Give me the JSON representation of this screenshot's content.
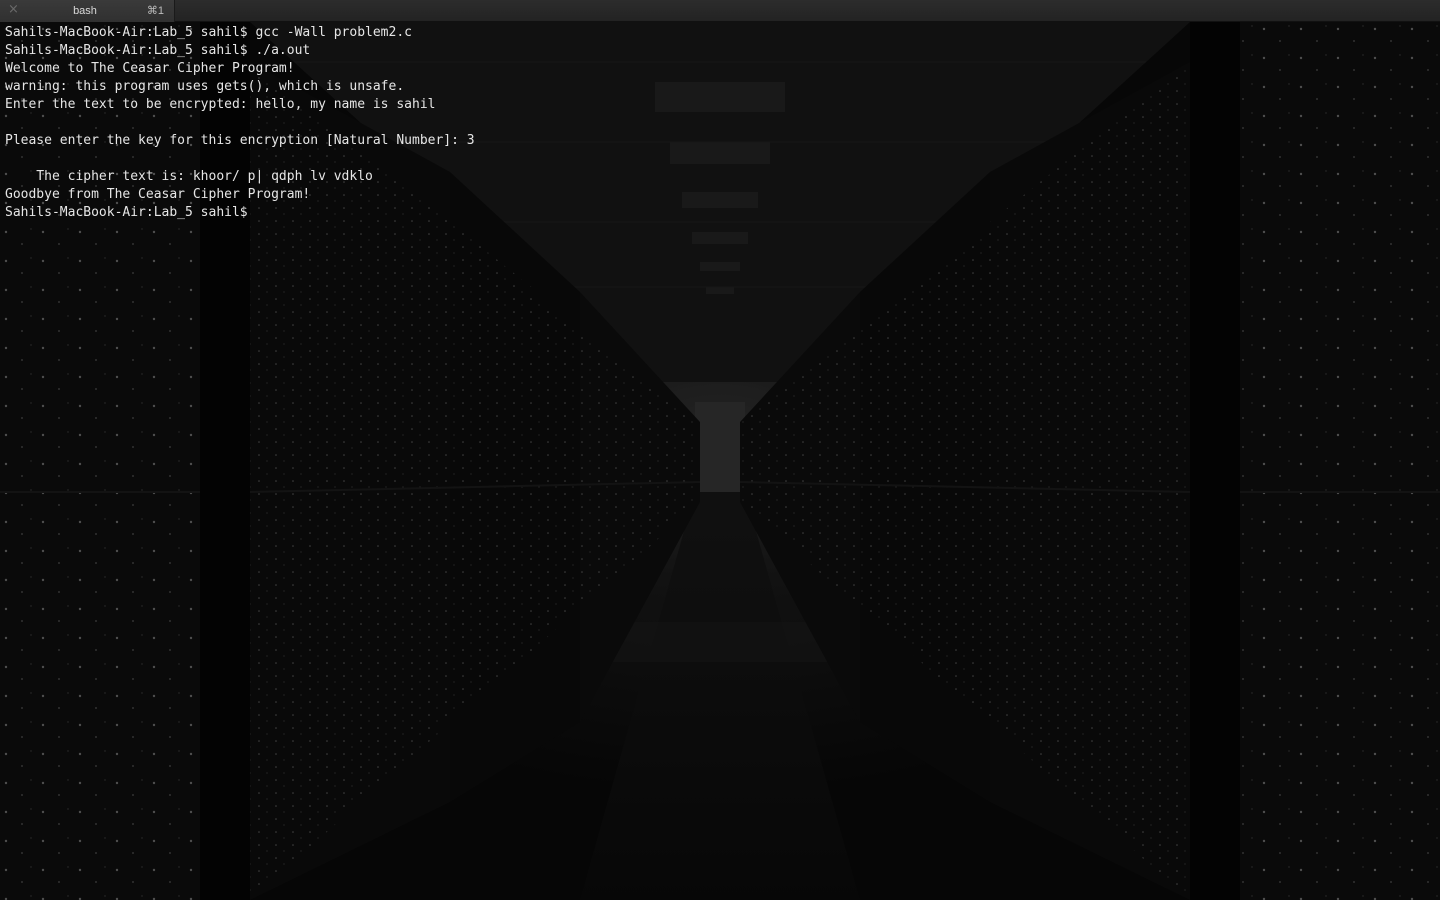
{
  "tab": {
    "close_icon": "×",
    "title": "bash",
    "shortcut": "⌘1"
  },
  "terminal": {
    "lines": [
      "Sahils-MacBook-Air:Lab_5 sahil$ gcc -Wall problem2.c",
      "Sahils-MacBook-Air:Lab_5 sahil$ ./a.out",
      "Welcome to The Ceasar Cipher Program!",
      "warning: this program uses gets(), which is unsafe.",
      "Enter the text to be encrypted: hello, my name is sahil",
      "",
      "Please enter the key for this encryption [Natural Number]: 3",
      "",
      "    The cipher text is: khoor/ p| qdph lv vdklo",
      "Goodbye from The Ceasar Cipher Program!",
      "Sahils-MacBook-Air:Lab_5 sahil$ "
    ]
  },
  "colors": {
    "text": "#e6e6e6",
    "background": "#090909",
    "tabbar": "#2a2a2a"
  }
}
